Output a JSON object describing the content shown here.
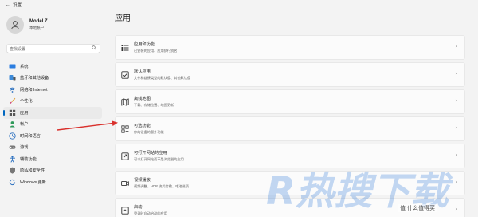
{
  "window": {
    "title": "设置",
    "back_glyph": "←"
  },
  "profile": {
    "name": "Model Z",
    "account_type": "本地帐户"
  },
  "search": {
    "placeholder": "查找设置"
  },
  "nav": {
    "items": [
      {
        "label": "系统",
        "icon": "monitor-icon",
        "active": false
      },
      {
        "label": "蓝牙和其他设备",
        "icon": "bluetooth-icon",
        "active": false
      },
      {
        "label": "网络和 Internet",
        "icon": "wifi-icon",
        "active": false
      },
      {
        "label": "个性化",
        "icon": "brush-icon",
        "active": false
      },
      {
        "label": "应用",
        "icon": "apps-icon",
        "active": true
      },
      {
        "label": "帐户",
        "icon": "person-icon",
        "active": false
      },
      {
        "label": "时间和语言",
        "icon": "clock-globe-icon",
        "active": false
      },
      {
        "label": "游戏",
        "icon": "gamepad-icon",
        "active": false
      },
      {
        "label": "辅助功能",
        "icon": "accessibility-icon",
        "active": false
      },
      {
        "label": "隐私和安全性",
        "icon": "shield-icon",
        "active": false
      },
      {
        "label": "Windows 更新",
        "icon": "update-icon",
        "active": false
      }
    ]
  },
  "main": {
    "title": "应用",
    "cards": [
      {
        "title": "应用和功能",
        "desc": "已安装的应用、应用执行别名",
        "icon": "apps-list-icon"
      },
      {
        "title": "默认应用",
        "desc": "文件和链接类型的默认值、其他默认值",
        "icon": "default-apps-icon"
      },
      {
        "title": "离线地图",
        "desc": "下载、存储位置、地图更新",
        "icon": "map-icon"
      },
      {
        "title": "可选功能",
        "desc": "你的设备的额外功能",
        "icon": "optional-features-icon"
      },
      {
        "title": "可打开网站的应用",
        "desc": "可以打开网站而不是浏览器的应用",
        "icon": "website-apps-icon"
      },
      {
        "title": "视频播放",
        "desc": "视频调整、HDR 流式传输、电池选项",
        "icon": "video-icon"
      },
      {
        "title": "启动",
        "desc": "登录时自动启动的应用",
        "icon": "startup-icon"
      }
    ],
    "chevron": "›"
  },
  "watermark": {
    "brand": "R热搜下载",
    "site": "值 什么值得买"
  },
  "colors": {
    "accent": "#0067c0",
    "arrow": "#d9302c",
    "background": "#f3f3f3",
    "card": "#fbfbfb"
  }
}
